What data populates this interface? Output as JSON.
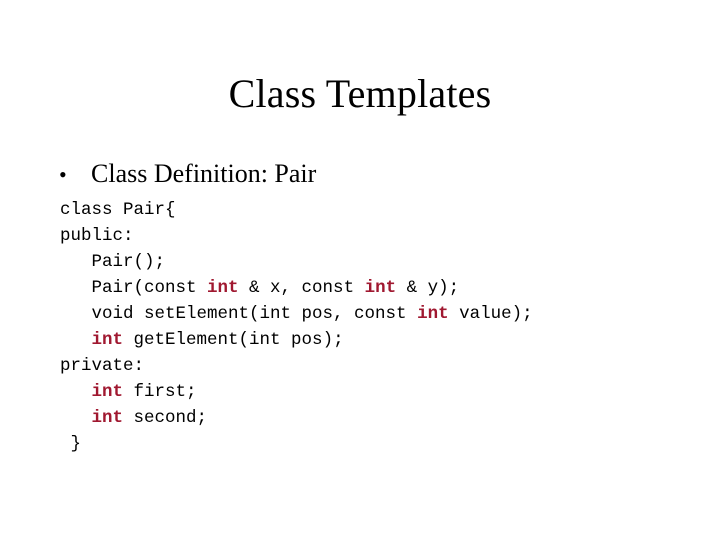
{
  "slide": {
    "title": "Class Templates",
    "background_color": "#FFFFFF",
    "text_color": "#000000",
    "keyword_color": "#A01830"
  },
  "bullets": [
    {
      "marker": "•",
      "text": "Class Definition: Pair"
    }
  ],
  "code": {
    "language": "cpp",
    "lines": [
      {
        "id": "line-class-pair",
        "segments": [
          {
            "text": "class Pair{",
            "kind": "plain"
          }
        ]
      },
      {
        "id": "line-public",
        "segments": [
          {
            "text": "public:",
            "kind": "plain"
          }
        ]
      },
      {
        "id": "line-default-ctor",
        "segments": [
          {
            "text": "   Pair();",
            "kind": "plain"
          }
        ]
      },
      {
        "id": "line-param-ctor",
        "segments": [
          {
            "text": "   Pair(const ",
            "kind": "plain"
          },
          {
            "text": "int",
            "kind": "keyword"
          },
          {
            "text": " & x, const ",
            "kind": "plain"
          },
          {
            "text": "int",
            "kind": "keyword"
          },
          {
            "text": " & y);",
            "kind": "plain"
          }
        ]
      },
      {
        "id": "line-set-element",
        "segments": [
          {
            "text": "   void setElement(int pos, const ",
            "kind": "plain"
          },
          {
            "text": "int",
            "kind": "keyword"
          },
          {
            "text": " value);",
            "kind": "plain"
          }
        ]
      },
      {
        "id": "line-get-element",
        "segments": [
          {
            "text": "   ",
            "kind": "plain"
          },
          {
            "text": "int",
            "kind": "keyword"
          },
          {
            "text": " getElement(int pos);",
            "kind": "plain"
          }
        ]
      },
      {
        "id": "line-private",
        "segments": [
          {
            "text": "private:",
            "kind": "plain"
          }
        ]
      },
      {
        "id": "line-member-first",
        "segments": [
          {
            "text": "   ",
            "kind": "plain"
          },
          {
            "text": "int",
            "kind": "keyword"
          },
          {
            "text": " first;",
            "kind": "plain"
          }
        ]
      },
      {
        "id": "line-member-second",
        "segments": [
          {
            "text": "   ",
            "kind": "plain"
          },
          {
            "text": "int",
            "kind": "keyword"
          },
          {
            "text": " second;",
            "kind": "plain"
          }
        ]
      },
      {
        "id": "line-close-brace",
        "segments": [
          {
            "text": " }",
            "kind": "plain"
          }
        ]
      }
    ]
  }
}
